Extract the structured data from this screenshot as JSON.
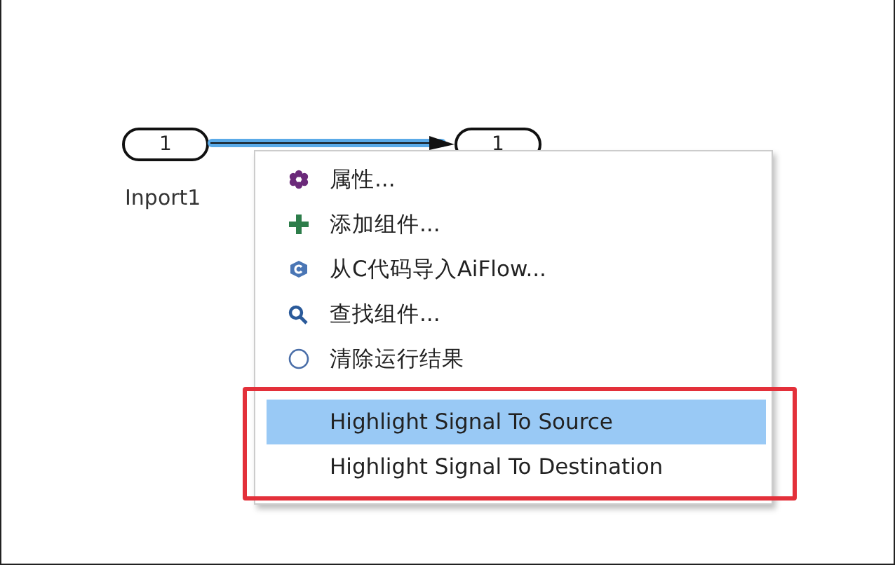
{
  "canvas": {
    "blocks": [
      {
        "label": "1",
        "name": "Inport1"
      },
      {
        "label": "1"
      }
    ],
    "signal": {
      "highlighted": true
    }
  },
  "context_menu": {
    "sections": [
      {
        "outlined": false,
        "items": [
          {
            "label": "属性...",
            "selected": false
          },
          {
            "label": "添加组件...",
            "selected": false
          },
          {
            "label": "从C代码导入AiFlow...",
            "selected": false
          },
          {
            "label": "查找组件...",
            "selected": false
          },
          {
            "label": "清除运行结果",
            "selected": false
          }
        ]
      },
      {
        "outlined": true,
        "items": [
          {
            "label": "Highlight Signal To Source",
            "selected": true
          },
          {
            "label": "Highlight Signal To Destination",
            "selected": false
          }
        ]
      }
    ]
  }
}
